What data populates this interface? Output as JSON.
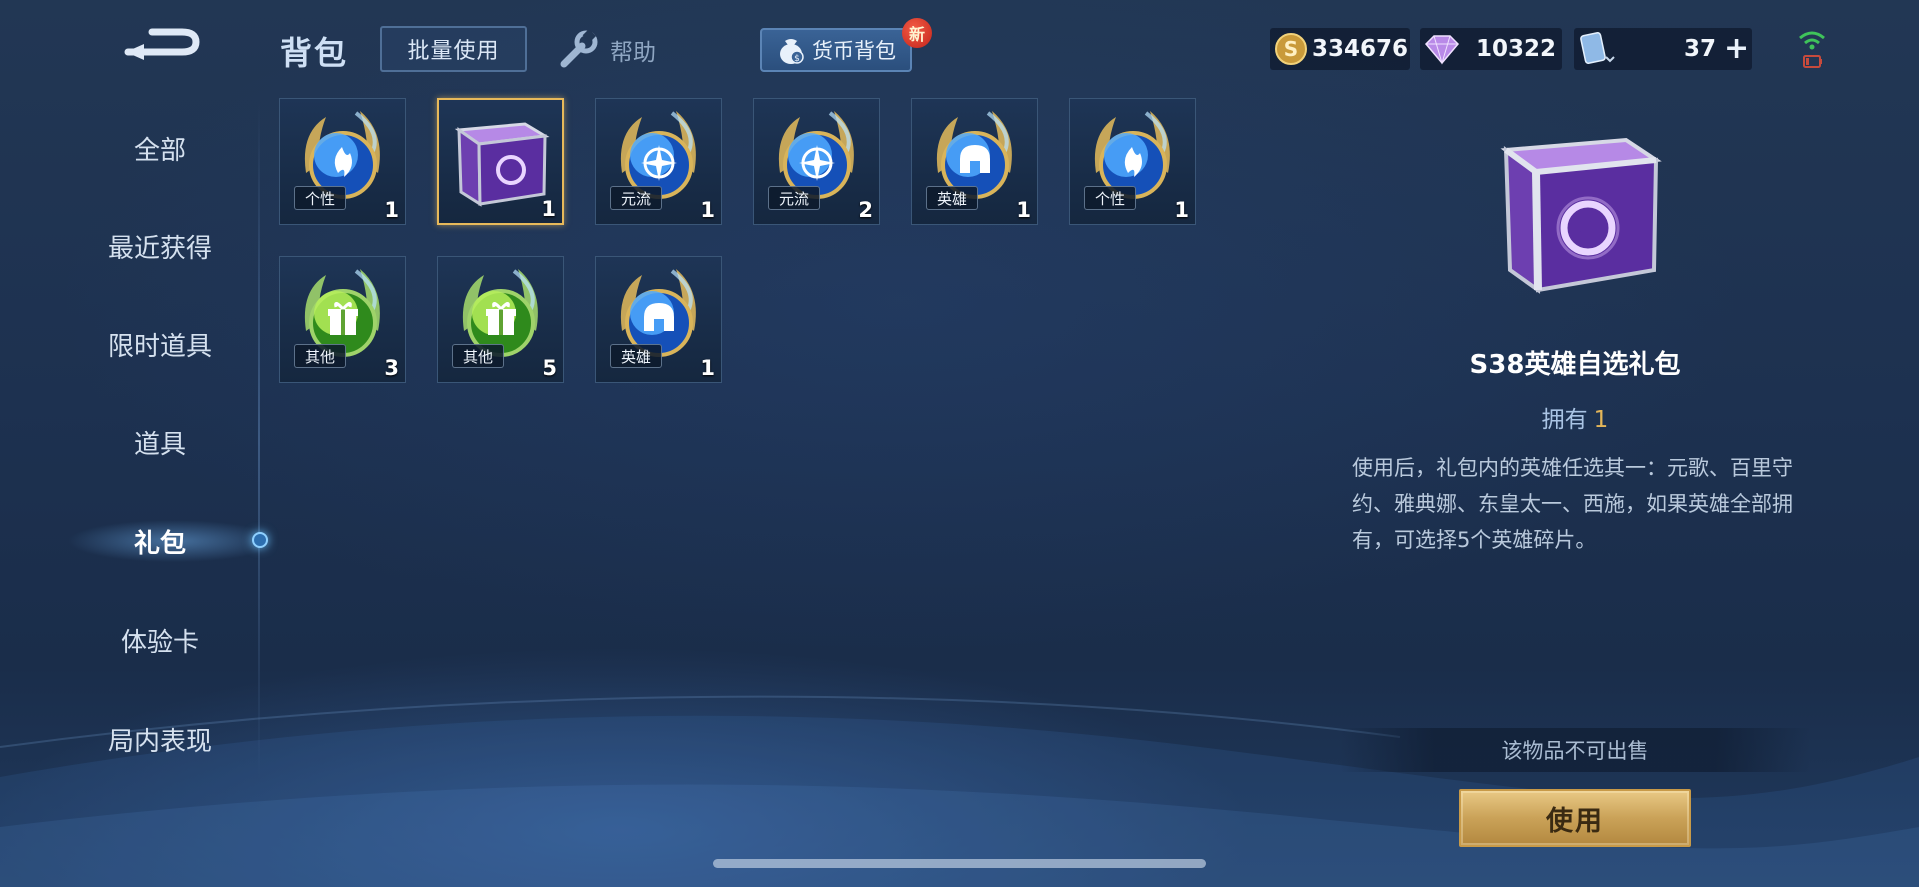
{
  "header": {
    "back_icon": "back-arrow-icon",
    "title": "背包",
    "batch_use_label": "批量使用",
    "help_label": "帮助",
    "currency_bag_label": "货币背包",
    "new_badge": "新"
  },
  "currency": {
    "gold": "334676",
    "diamonds": "10322",
    "tickets": "37",
    "plus_label": "+"
  },
  "sidebar": {
    "items": [
      {
        "label": "全部"
      },
      {
        "label": "最近获得"
      },
      {
        "label": "限时道具"
      },
      {
        "label": "道具"
      },
      {
        "label": "礼包"
      },
      {
        "label": "体验卡"
      },
      {
        "label": "局内表现"
      }
    ],
    "active_index": 4
  },
  "grid": {
    "items": [
      {
        "type": "blue-orb",
        "emblem": "flame",
        "tag": "个性",
        "qty": "1"
      },
      {
        "type": "purple-chest",
        "emblem": "",
        "tag": "",
        "qty": "1",
        "selected": true
      },
      {
        "type": "blue-orb",
        "emblem": "compass",
        "tag": "元流",
        "qty": "1"
      },
      {
        "type": "blue-orb",
        "emblem": "compass",
        "tag": "元流",
        "qty": "2"
      },
      {
        "type": "blue-orb",
        "emblem": "helmet",
        "tag": "英雄",
        "qty": "1"
      },
      {
        "type": "blue-orb",
        "emblem": "flame",
        "tag": "个性",
        "qty": "1"
      },
      {
        "type": "green-orb",
        "emblem": "gift",
        "tag": "其他",
        "qty": "3"
      },
      {
        "type": "green-orb",
        "emblem": "gift",
        "tag": "其他",
        "qty": "5"
      },
      {
        "type": "blue-orb",
        "emblem": "helmet",
        "tag": "英雄",
        "qty": "1"
      }
    ]
  },
  "detail": {
    "name": "S38英雄自选礼包",
    "own_label": "拥有",
    "own_count": "1",
    "description": "使用后，礼包内的英雄任选其一：元歌、百里守约、雅典娜、东皇太一、西施，如果英雄全部拥有，可选择5个英雄碎片。",
    "sell_note": "该物品不可出售",
    "use_label": "使用"
  },
  "colors": {
    "accent_gold": "#e4b659",
    "selection_border": "#e7b95a",
    "wallet_blue": "#3a6396"
  }
}
